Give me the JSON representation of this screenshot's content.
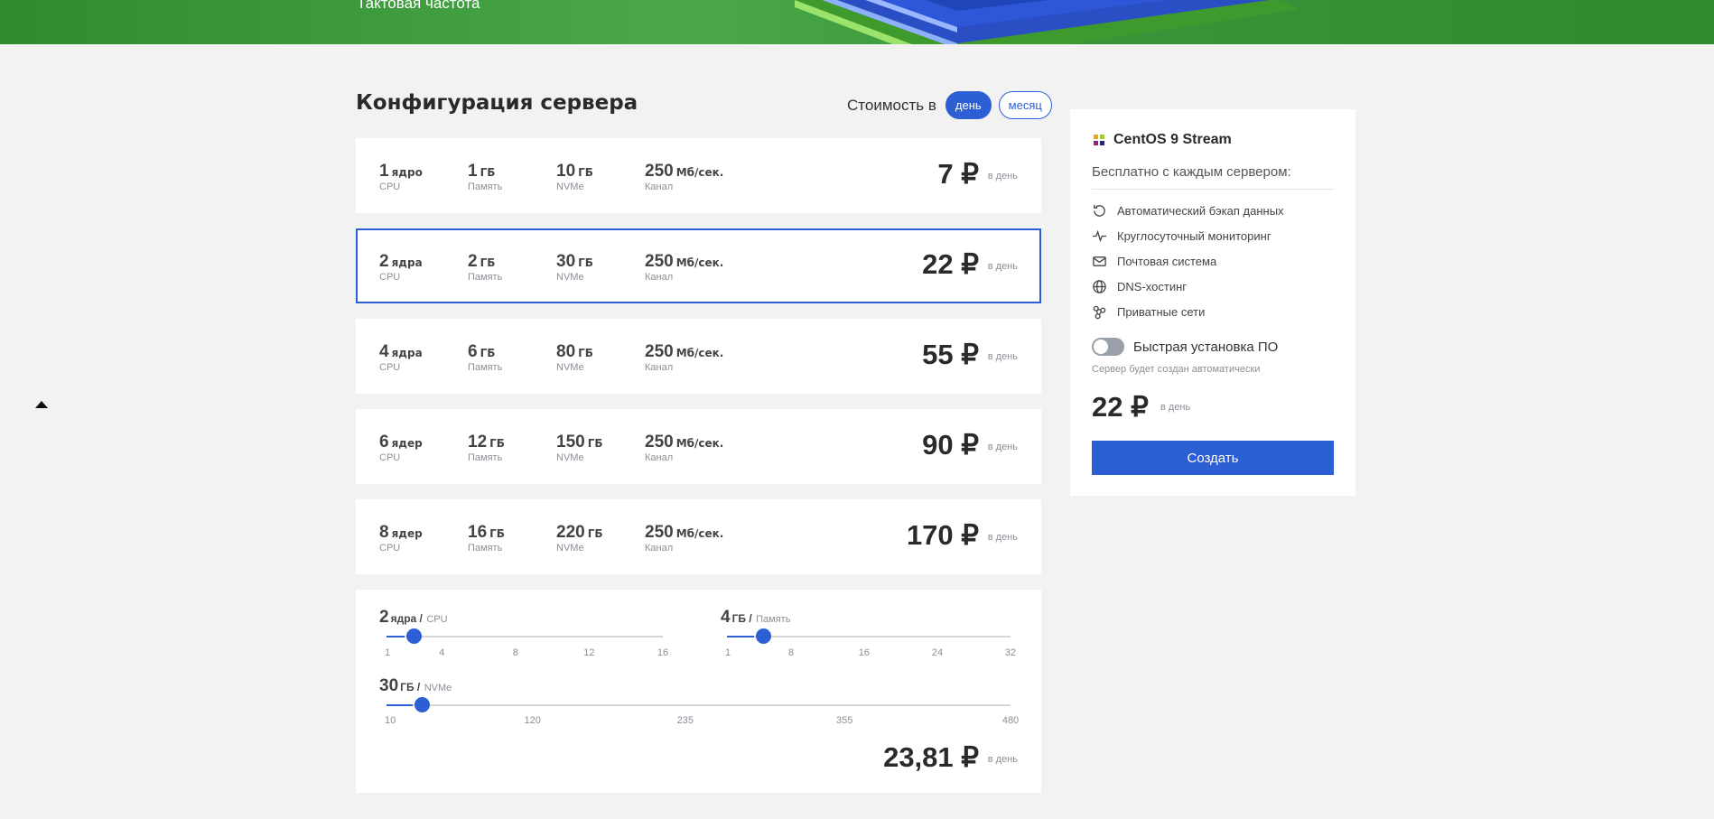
{
  "hero": {
    "subtitle": "Тактовая частота"
  },
  "config": {
    "title": "Конфигурация сервера",
    "price_mode_label": "Стоимость в",
    "mode_day": "день",
    "mode_month": "месяц"
  },
  "plans": [
    {
      "cpu": "1",
      "cpu_unit": "ядро",
      "ram": "1",
      "ram_unit": "ГБ",
      "disk": "10",
      "disk_unit": "ГБ",
      "net": "250",
      "net_unit": "Мб/сек.",
      "price": "7 ₽",
      "per": "в день",
      "selected": false
    },
    {
      "cpu": "2",
      "cpu_unit": "ядра",
      "ram": "2",
      "ram_unit": "ГБ",
      "disk": "30",
      "disk_unit": "ГБ",
      "net": "250",
      "net_unit": "Мб/сек.",
      "price": "22 ₽",
      "per": "в день",
      "selected": true
    },
    {
      "cpu": "4",
      "cpu_unit": "ядра",
      "ram": "6",
      "ram_unit": "ГБ",
      "disk": "80",
      "disk_unit": "ГБ",
      "net": "250",
      "net_unit": "Мб/сек.",
      "price": "55 ₽",
      "per": "в день",
      "selected": false
    },
    {
      "cpu": "6",
      "cpu_unit": "ядер",
      "ram": "12",
      "ram_unit": "ГБ",
      "disk": "150",
      "disk_unit": "ГБ",
      "net": "250",
      "net_unit": "Мб/сек.",
      "price": "90 ₽",
      "per": "в день",
      "selected": false
    },
    {
      "cpu": "8",
      "cpu_unit": "ядер",
      "ram": "16",
      "ram_unit": "ГБ",
      "disk": "220",
      "disk_unit": "ГБ",
      "net": "250",
      "net_unit": "Мб/сек.",
      "price": "170 ₽",
      "per": "в день",
      "selected": false
    }
  ],
  "spec_captions": {
    "cpu": "CPU",
    "ram": "Память",
    "disk": "NVMe",
    "net": "Канал"
  },
  "custom": {
    "cpu": {
      "value": "2",
      "unit": "ядра /",
      "caption": "CPU",
      "ticks": [
        "1",
        "4",
        "8",
        "12",
        "16"
      ],
      "level": 2,
      "min": 1,
      "max": 16
    },
    "ram": {
      "value": "4",
      "unit": "ГБ /",
      "caption": "Память",
      "ticks": [
        "1",
        "8",
        "16",
        "24",
        "32"
      ],
      "level": 4,
      "min": 1,
      "max": 32
    },
    "disk": {
      "value": "30",
      "unit": "ГБ /",
      "caption": "NVMe",
      "ticks": [
        "10",
        "120",
        "235",
        "355",
        "480"
      ],
      "level": 30,
      "min": 10,
      "max": 480
    },
    "price": "23,81 ₽",
    "per": "в день"
  },
  "panel": {
    "os_name": "CentOS 9 Stream",
    "free_title": "Бесплатно с каждым сервером:",
    "features": [
      "Автоматический бэкап данных",
      "Круглосуточный мониторинг",
      "Почтовая система",
      "DNS-хостинг",
      "Приватные сети"
    ],
    "toggle_label": "Быстрая установка ПО",
    "toggle_note": "Сервер будет создан автоматически",
    "toggle_on": false,
    "price": "22 ₽",
    "per": "в день",
    "create_label": "Создать"
  },
  "colors": {
    "accent": "#2c5fd4",
    "hero_green": "#3a963a"
  }
}
